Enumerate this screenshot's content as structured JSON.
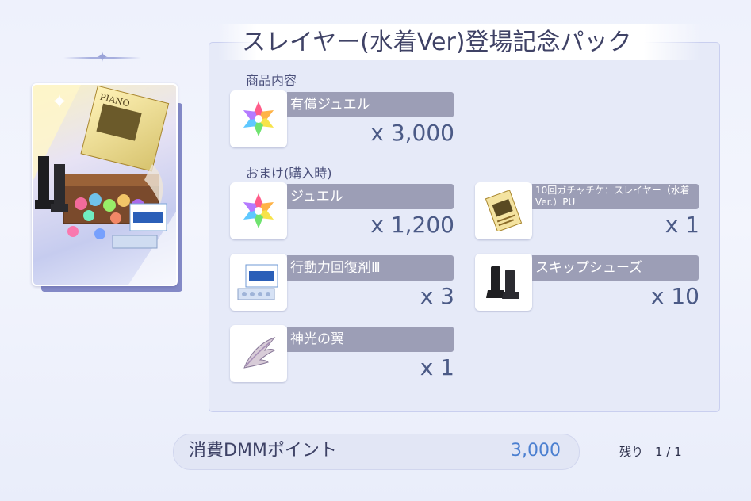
{
  "title": "スレイヤー(水着Ver)登場記念パック",
  "pack_image": "pack-image",
  "contents_label": "商品内容",
  "contents": [
    {
      "name": "有償ジュエル",
      "qty": "x 3,000",
      "icon": "jewel-icon"
    }
  ],
  "bonus_label": "おまけ(購入時)",
  "bonus": [
    {
      "name": "ジュエル",
      "qty": "x 1,200",
      "icon": "jewel-icon"
    },
    {
      "name": "10回ガチャチケ：スレイヤー（水着Ver.）PU",
      "qty": "x 1",
      "icon": "gacha-ticket-icon"
    },
    {
      "name": "行動力回復剤Ⅲ",
      "qty": "x 3",
      "icon": "recovery-box-icon"
    },
    {
      "name": "スキップシューズ",
      "qty": "x 10",
      "icon": "boots-icon"
    },
    {
      "name": "神光の翼",
      "qty": "x 1",
      "icon": "wing-icon"
    }
  ],
  "cost": {
    "label": "消費DMMポイント",
    "value": "3,000"
  },
  "remaining": "残り　1 / 1",
  "colors": {
    "accent_value": "#4b7fd0",
    "name_bar": "#9c9eb6",
    "panel": "#e6eaf8"
  }
}
